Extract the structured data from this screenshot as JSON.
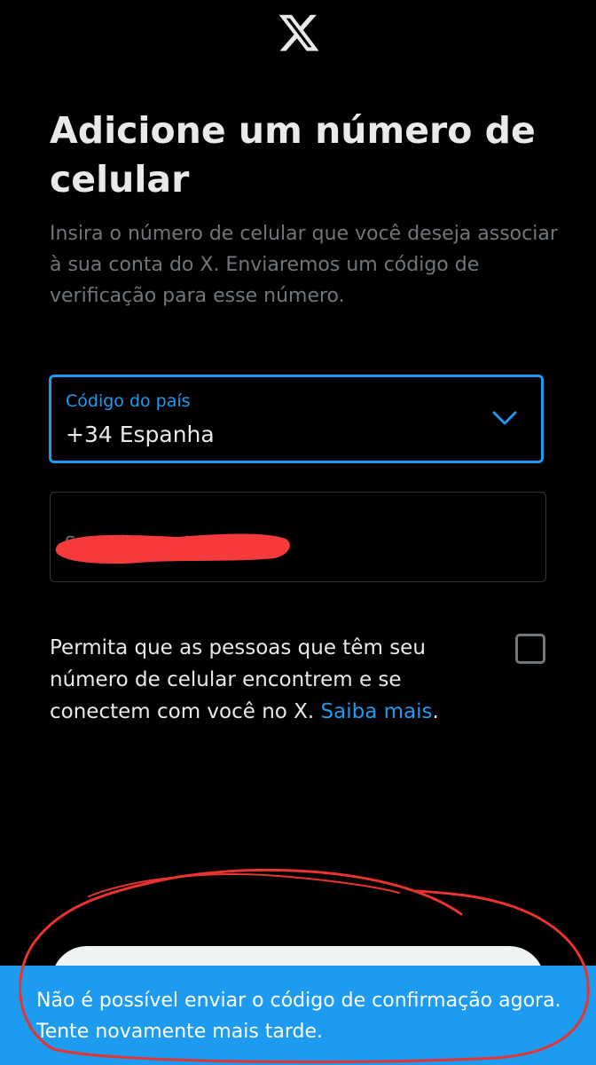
{
  "header": {
    "logo_icon": "x-logo-icon"
  },
  "page": {
    "title": "Adicione um número de celular",
    "subtitle": "Insira o número de celular que você deseja associar à sua conta do X. Enviaremos um código de verificação para esse número."
  },
  "country_select": {
    "label": "Código do país",
    "value": "+34 Espanha",
    "icon": "chevron-down-icon"
  },
  "phone_input": {
    "placeholder": "Seu número de celular"
  },
  "discoverability": {
    "text": "Permita que as pessoas que têm seu número de celular encontrem e se conectem com você no X.",
    "link": "Saiba mais",
    "checked": false
  },
  "toast": {
    "message": "Não é possível enviar o código de confirmação agora. Tente novamente mais tarde."
  },
  "colors": {
    "background": "#000000",
    "accent": "#1d9bf0",
    "text_primary": "#e7e9ea",
    "text_secondary": "#71767b",
    "redaction": "#f43a3a",
    "annotation": "#e8332f"
  }
}
